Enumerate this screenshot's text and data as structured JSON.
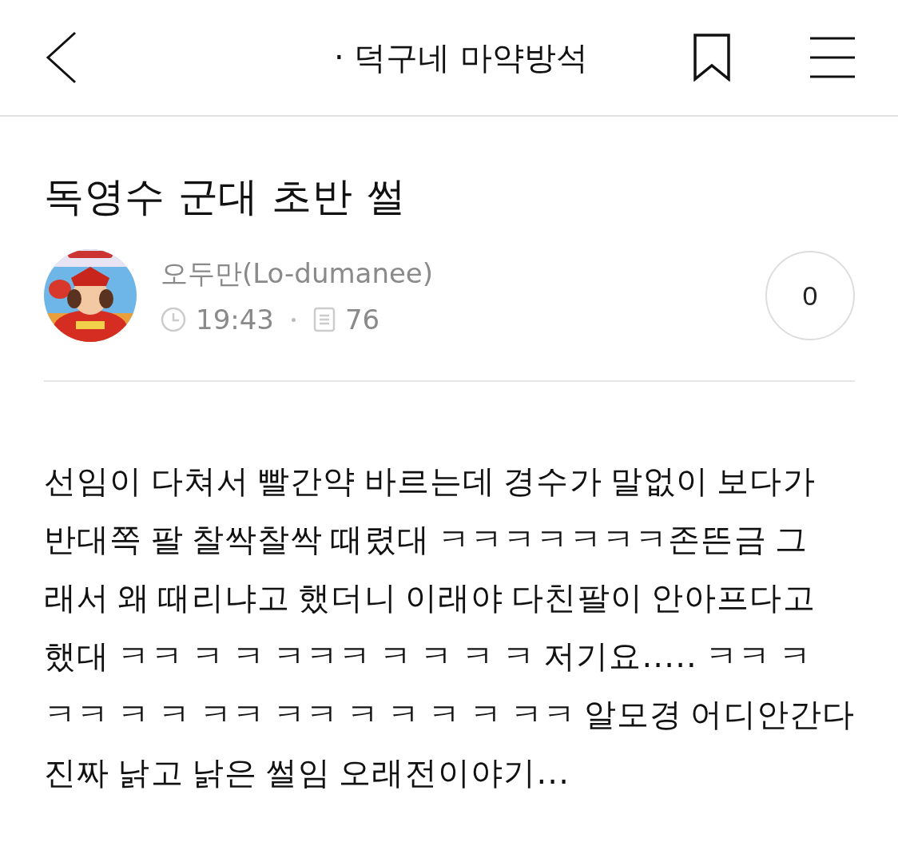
{
  "header": {
    "board_title": "· 덕구네 마약방석"
  },
  "post": {
    "title": "독영수 군대 초반 썰",
    "author": "오두만(Lo-dumanee)",
    "time": "19:43",
    "views": "76",
    "comment_count": "0",
    "body_lines": [
      "선임이 다쳐서 빨간약 바르는데 경수가 말없이 보다가",
      "반대쪽 팔 찰싹찰싹 때렸대 ㅋㅋㅋㅋㅋㅋㅋ존뜬금 그",
      "래서 왜 때리냐고 했더니 이래야 다친팔이 안아프다고",
      "했대 ㅋㅋ ㅋ ㅋ ㅋㅋㅋ ㅋ ㅋ ㅋ ㅋ 저기요..... ㅋㅋ ㅋ",
      "ㅋㅋ ㅋ ㅋ ㅋㅋ ㅋㅋ ㅋ ㅋ ㅋ ㅋ ㅋㅋ 알모경 어디안간다",
      "진짜 낡고 낡은 썰임 오래전이야기..."
    ]
  }
}
